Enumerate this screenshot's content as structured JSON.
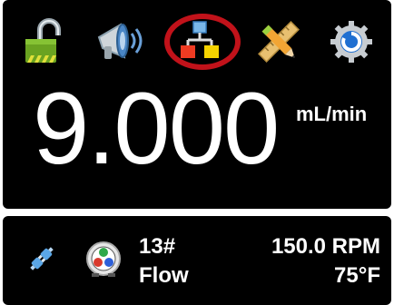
{
  "toolbar": {
    "items": [
      {
        "icon": "unlock-icon"
      },
      {
        "icon": "megaphone-icon"
      },
      {
        "icon": "network-icon"
      },
      {
        "icon": "edit-ruler-pencil-icon"
      },
      {
        "icon": "settings-gear-icon"
      }
    ],
    "selected_index": 2,
    "highlight_color": "#c1121a"
  },
  "display": {
    "flow_rate": "9.000",
    "flow_unit": "mL/min"
  },
  "status": {
    "connection_icon": "plug-connected-icon",
    "pump_head_icon": "pump-head-icon",
    "channel": "13#",
    "mode": "Flow",
    "speed": "150.0 RPM",
    "temperature": "75°F"
  }
}
